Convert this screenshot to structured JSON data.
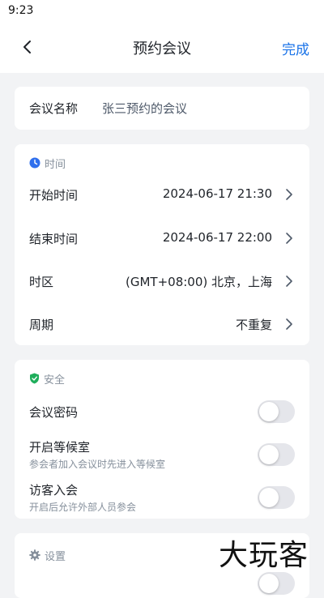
{
  "status_bar": {
    "time": "9:23"
  },
  "nav": {
    "title": "预约会议",
    "done_label": "完成"
  },
  "meeting_name": {
    "label": "会议名称",
    "value": "张三预约的会议"
  },
  "time_section": {
    "header": "时间",
    "rows": [
      {
        "label": "开始时间",
        "value": "2024-06-17 21:30"
      },
      {
        "label": "结束时间",
        "value": "2024-06-17 22:00"
      },
      {
        "label": "时区",
        "value": "(GMT+08:00) 北京，上海"
      },
      {
        "label": "周期",
        "value": "不重复"
      }
    ]
  },
  "security_section": {
    "header": "安全",
    "items": [
      {
        "label": "会议密码",
        "sub": "",
        "enabled": false
      },
      {
        "label": "开启等候室",
        "sub": "参会者加入会议时先进入等候室",
        "enabled": false
      },
      {
        "label": "访客入会",
        "sub": "开启后允许外部人员参会",
        "enabled": false
      }
    ]
  },
  "settings_section": {
    "header": "设置"
  },
  "watermark": "大玩客",
  "colors": {
    "accent": "#1a73e8",
    "clock_icon": "#2f6fed",
    "shield_icon": "#1fae5b",
    "background": "#f2f3f5"
  }
}
